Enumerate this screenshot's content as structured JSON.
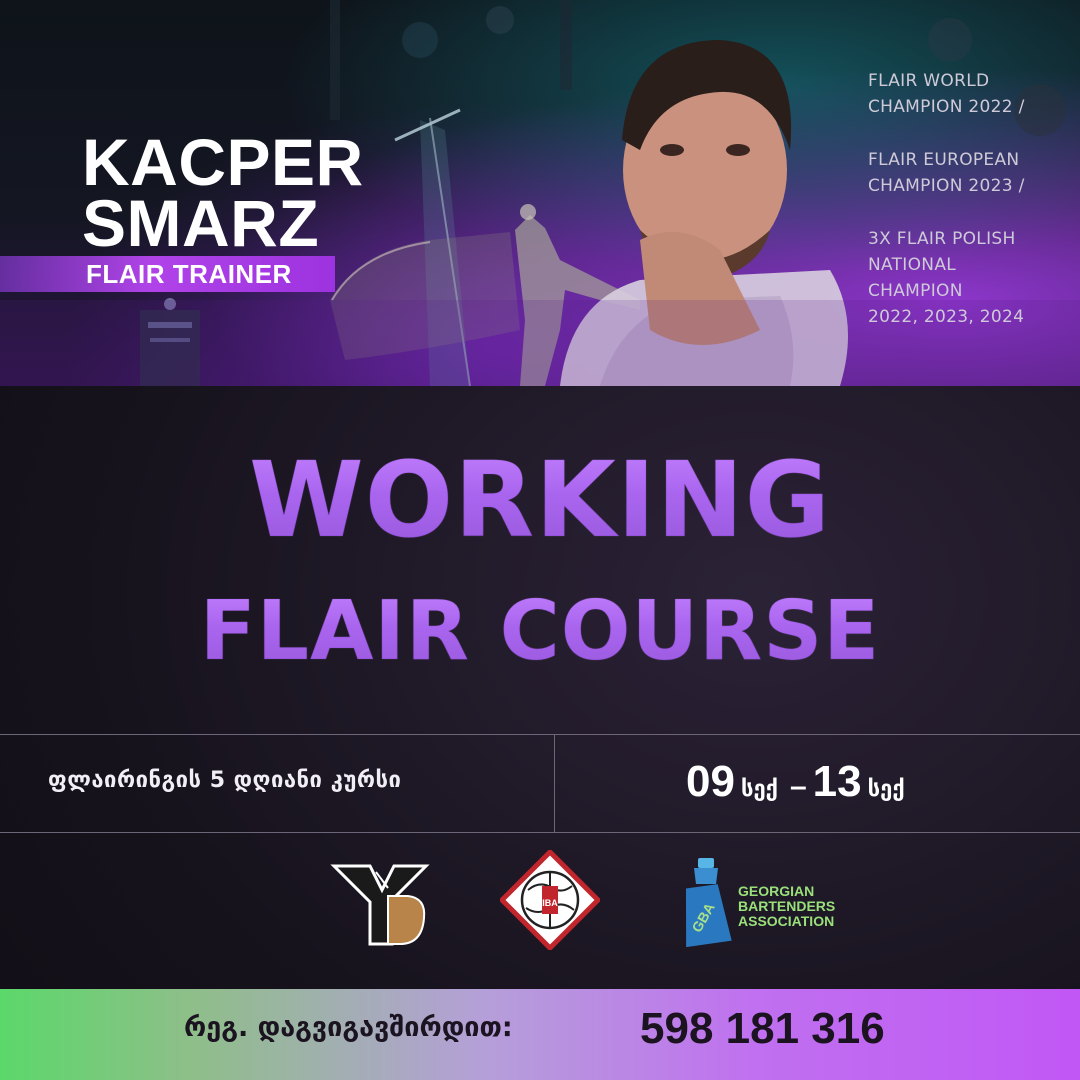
{
  "trainer": {
    "first_name": "KACPER",
    "last_name": "SMARZ",
    "role": "FLAIR TRAINER"
  },
  "achievements": [
    {
      "line1": "FLAIR WORLD",
      "line2": "CHAMPION 2022 /"
    },
    {
      "line1": "FLAIR EUROPEAN",
      "line2": "CHAMPION 2023 /"
    },
    {
      "line1": "3X FLAIR POLISH",
      "line2": "NATIONAL",
      "line3": "CHAMPION",
      "line4": "2022, 2023, 2024"
    }
  ],
  "headline": {
    "line1": "WORKING",
    "line2": "FLAIR COURSE"
  },
  "course": {
    "description": "ფლაირინგის 5 დღიანი კურსი",
    "start_day": "09",
    "start_month": "სექ",
    "separator": "–",
    "end_day": "13",
    "end_month": "სექ"
  },
  "logos": {
    "iba_text": "IBA",
    "gba_short": "GBA",
    "gba_line1": "GEORGIAN",
    "gba_line2": "BARTENDERS",
    "gba_line3": "ASSOCIATION"
  },
  "footer": {
    "registration_label": "რეგ.  დაგვიგავშირდით:",
    "phone": "598 181 316"
  },
  "colors": {
    "accent_purple": "#9d33e0",
    "headline_purple": "#8a30e6",
    "gba_green": "#9ae07a",
    "footer_green": "#5bd86a",
    "footer_purple": "#c157f5"
  },
  "icons": [
    "trophy-icon",
    "yb-logo-icon",
    "iba-logo-icon",
    "gba-shaker-icon"
  ]
}
